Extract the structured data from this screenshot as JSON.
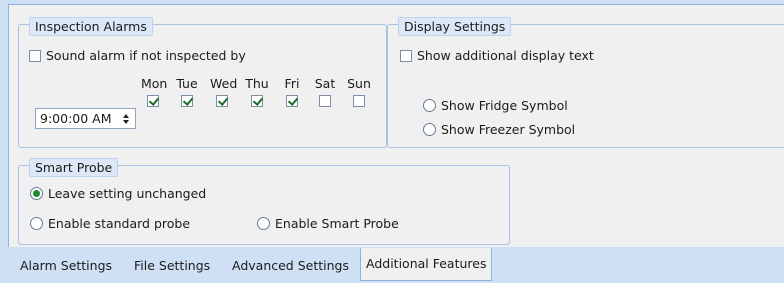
{
  "inspection_alarms": {
    "title": "Inspection Alarms",
    "sound_alarm_label": "Sound alarm if not inspected by",
    "sound_alarm_checked": false,
    "time_value": "9:00:00 AM",
    "days": [
      {
        "label": "Mon",
        "checked": true
      },
      {
        "label": "Tue",
        "checked": true
      },
      {
        "label": "Wed",
        "checked": true
      },
      {
        "label": "Thu",
        "checked": true
      },
      {
        "label": "Fri",
        "checked": true
      },
      {
        "label": "Sat",
        "checked": false
      },
      {
        "label": "Sun",
        "checked": false
      }
    ]
  },
  "display_settings": {
    "title": "Display Settings",
    "show_text_label": "Show additional display text",
    "show_text_checked": false,
    "fridge_label": "Show Fridge Symbol",
    "freezer_label": "Show Freezer Symbol"
  },
  "smart_probe": {
    "title": "Smart Probe",
    "options": [
      {
        "label": "Leave setting unchanged",
        "selected": true
      },
      {
        "label": "Enable standard probe",
        "selected": false
      },
      {
        "label": "Enable Smart Probe",
        "selected": false
      }
    ]
  },
  "tabs": [
    {
      "label": "Alarm Settings",
      "active": false
    },
    {
      "label": "File Settings",
      "active": false
    },
    {
      "label": "Advanced Settings",
      "active": false
    },
    {
      "label": "Additional Features",
      "active": true
    }
  ],
  "colors": {
    "group_border": "#aac3e3",
    "title_bg": "#dce8f7",
    "tab_strip": "#cfe0f5",
    "radio_selected": "#1f8a2e"
  }
}
